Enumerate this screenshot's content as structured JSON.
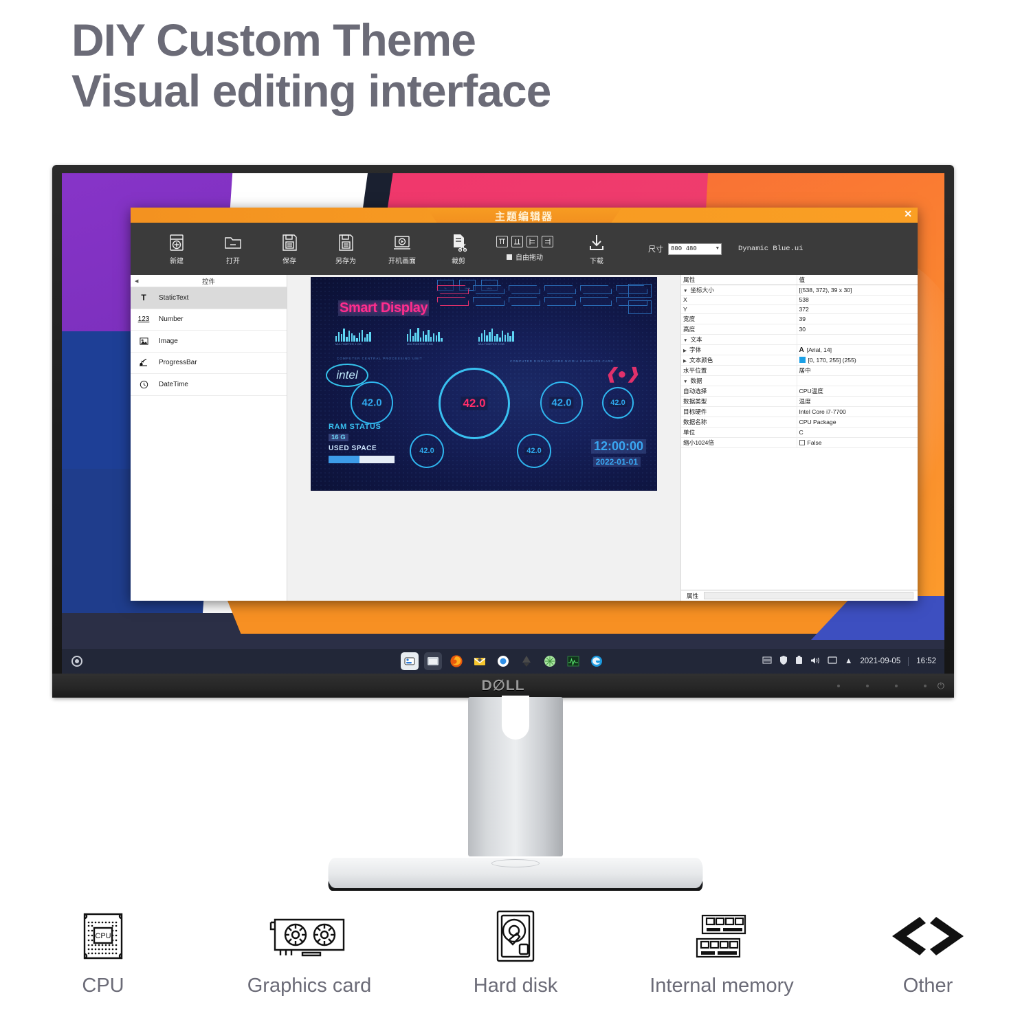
{
  "headline": {
    "line1": "DIY Custom Theme",
    "line2": "Visual editing interface"
  },
  "monitor": {
    "brand": "D∅LL"
  },
  "app": {
    "title": "主题编辑器",
    "close_label": "✕",
    "toolbar": {
      "buttons": [
        {
          "label": "新建",
          "icon": "new-file-icon"
        },
        {
          "label": "打开",
          "icon": "open-folder-icon"
        },
        {
          "label": "保存",
          "icon": "save-disk-icon"
        },
        {
          "label": "另存为",
          "icon": "save-as-disk-icon"
        },
        {
          "label": "开机画面",
          "icon": "boot-screen-icon"
        },
        {
          "label": "裁剪",
          "icon": "crop-scissors-icon"
        },
        {
          "label": "下载",
          "icon": "download-icon"
        }
      ],
      "align_buttons": [
        "align-top",
        "align-bottom",
        "align-left",
        "align-right"
      ],
      "free_drag_label": "自由拖动",
      "size_label": "尺寸",
      "size_value": "800 480",
      "file_name": "Dynamic Blue.ui"
    },
    "widgets_panel": {
      "header": "控件",
      "items": [
        {
          "label": "StaticText",
          "icon": "text-icon",
          "selected": true
        },
        {
          "label": "Number",
          "icon": "number-icon",
          "selected": false
        },
        {
          "label": "Image",
          "icon": "image-icon",
          "selected": false
        },
        {
          "label": "ProgressBar",
          "icon": "progressbar-icon",
          "selected": false
        },
        {
          "label": "DateTime",
          "icon": "clock-icon",
          "selected": false
        }
      ]
    },
    "properties_panel": {
      "col_property": "属性",
      "col_value": "值",
      "footer_label": "属性",
      "rows": [
        {
          "indent": 0,
          "caret": "∨",
          "name": "坐标大小",
          "value": "[(538, 372), 39 x 30]",
          "kind": "group"
        },
        {
          "indent": 2,
          "caret": "",
          "name": "X",
          "value": "538",
          "kind": "plain"
        },
        {
          "indent": 2,
          "caret": "",
          "name": "Y",
          "value": "372",
          "kind": "plain"
        },
        {
          "indent": 2,
          "caret": "",
          "name": "宽度",
          "value": "39",
          "kind": "plain"
        },
        {
          "indent": 2,
          "caret": "",
          "name": "高度",
          "value": "30",
          "kind": "plain"
        },
        {
          "indent": 0,
          "caret": "∨",
          "name": "文本",
          "value": "",
          "kind": "group"
        },
        {
          "indent": 2,
          "caret": "›",
          "name": "字体",
          "value": "[Arial, 14]",
          "kind": "font"
        },
        {
          "indent": 2,
          "caret": "›",
          "name": "文本颜色",
          "value": "[0, 170, 255] (255)",
          "kind": "color"
        },
        {
          "indent": 1,
          "caret": "",
          "name": "水平位置",
          "value": "居中",
          "kind": "plain"
        },
        {
          "indent": 0,
          "caret": "∨",
          "name": "数据",
          "value": "",
          "kind": "group"
        },
        {
          "indent": 2,
          "caret": "",
          "name": "自动选择",
          "value": "CPU温度",
          "kind": "plain"
        },
        {
          "indent": 2,
          "caret": "",
          "name": "数据类型",
          "value": "温度",
          "kind": "plain"
        },
        {
          "indent": 2,
          "caret": "",
          "name": "目标硬件",
          "value": "Intel Core i7-7700",
          "kind": "plain"
        },
        {
          "indent": 2,
          "caret": "",
          "name": "数据名称",
          "value": "CPU Package",
          "kind": "plain"
        },
        {
          "indent": 2,
          "caret": "",
          "name": "单位",
          "value": "C",
          "kind": "plain"
        },
        {
          "indent": 2,
          "caret": "",
          "name": "缩小1024倍",
          "value": "False",
          "kind": "checkbox"
        }
      ],
      "color_swatch": "#1aa0e6"
    },
    "canvas": {
      "theme_title": "Smart Display",
      "cpu_caption": "COMPUTER CENTRAL PROCESSING UNIT",
      "gpu_caption": "COMPUTER DISPLAY CORE NVIDIA GRAPHICS CARD",
      "intel_label": "intel",
      "eq_captions": [
        "MULTIMETER 1     DB",
        "MULTIMETER 2     DB",
        "MULTIMETER 3     DB"
      ],
      "gauges": [
        "42.0",
        "42.0",
        "42.0",
        "42.0",
        "42.0",
        "42.0"
      ],
      "ram_title": "RAM STATUS",
      "ram_size": "16 G",
      "ram_used_label": "USED SPACE",
      "ram_percent": 47,
      "clock": "12:00:00",
      "date": "2022-01-01"
    }
  },
  "taskbar": {
    "icons": [
      "settings-icon",
      "files-icon",
      "firefox-icon",
      "mail-icon",
      "browser-icon",
      "inkscape-icon",
      "graph-icon",
      "monitor-icon",
      "edge-icon"
    ],
    "tray": [
      "keyboard-icon",
      "shield-icon",
      "clipboard-icon",
      "volume-icon",
      "display-icon",
      "show-hidden-icon"
    ],
    "date": "2021-09-05",
    "time": "16:52"
  },
  "features": [
    {
      "label": "CPU",
      "icon": "cpu-chip-icon"
    },
    {
      "label": "Graphics card",
      "icon": "gpu-card-icon"
    },
    {
      "label": "Hard disk",
      "icon": "hard-disk-icon"
    },
    {
      "label": "Internal memory",
      "icon": "ram-stick-icon"
    },
    {
      "label": "Other",
      "icon": "code-brackets-icon"
    }
  ],
  "colors": {
    "headline": "#6b6b77",
    "accent_orange": "#f79a22",
    "accent_pink": "#ff2d8e",
    "accent_cyan": "#39c0f0",
    "prop_blue": "#1aa0e6"
  }
}
